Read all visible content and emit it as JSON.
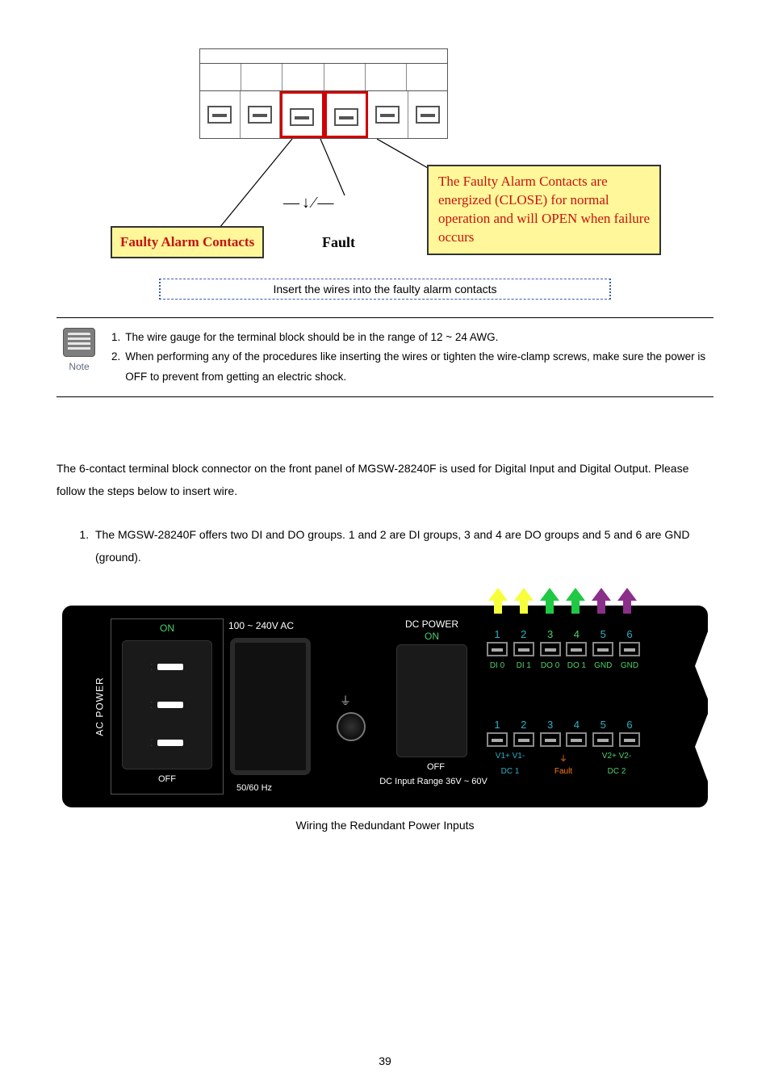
{
  "fig1": {
    "fault_symbol": "—↓⁄—",
    "fault_label": "Fault",
    "left_box": "Faulty Alarm Contacts",
    "right_box": "The  Faulty Alarm Contacts are energized (CLOSE) for normal operation and will OPEN when failure occurs",
    "caption": "Insert the wires into the faulty alarm contacts"
  },
  "note": {
    "icon_label": "Note",
    "items": [
      "The wire gauge for the terminal block should be in the range of 12 ~ 24 AWG.",
      "When performing any of the procedures like inserting the wires or tighten the wire-clamp screws, make sure the power is OFF to prevent from getting an electric shock."
    ]
  },
  "body": {
    "para": "The 6-contact terminal block connector on the front panel of MGSW-28240F is used for Digital Input and Digital Output. Please follow the steps below to insert wire.",
    "step1": "The MGSW-28240F offers two DI and DO groups. 1 and 2 are DI groups, 3 and 4 are DO groups and 5 and 6 are GND (ground)."
  },
  "device": {
    "ac_label": "AC POWER",
    "on": "ON",
    "off": "OFF",
    "ac_range": "100 ~ 240V AC",
    "hz": "50/60 Hz",
    "ground_symbol": "⏚",
    "dc_power": "DC POWER",
    "dc_off": "OFF",
    "dc_range": "DC Input Range 36V ~ 60V",
    "dido_nums": [
      "1",
      "2",
      "3",
      "4",
      "5",
      "6"
    ],
    "dido_labels": [
      "DI 0",
      "DI 1",
      "DO 0",
      "DO 1",
      "GND",
      "GND"
    ],
    "dc_nums": [
      "1",
      "2",
      "3",
      "4",
      "5",
      "6"
    ],
    "v_top_a": "V1+  V1-",
    "v_top_b": "⏚",
    "v_top_c": "V2+  V2-",
    "dc1": "DC 1",
    "fault": "Fault",
    "dc2": "DC 2"
  },
  "caption2": "Wiring the Redundant Power Inputs",
  "page_number": "39"
}
